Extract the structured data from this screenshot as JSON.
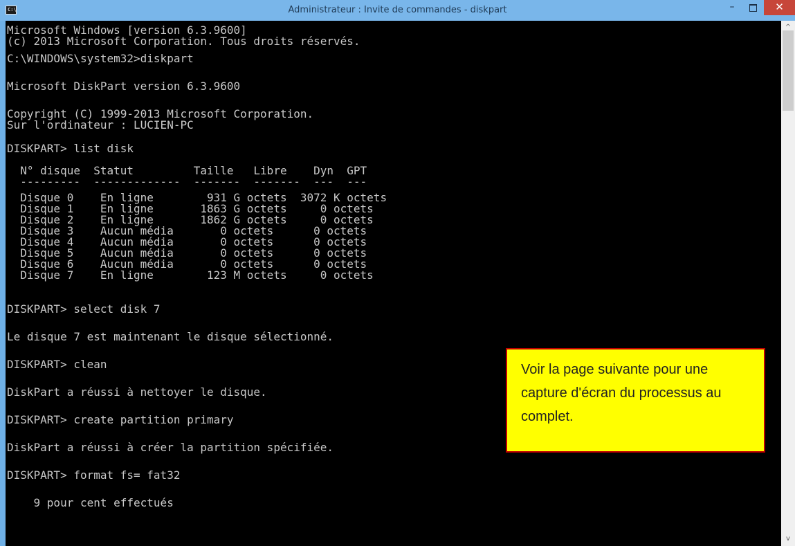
{
  "window": {
    "title": "Administrateur : Invite de commandes - diskpart",
    "icon_text": "C:\\",
    "min_glyph": "–",
    "close_glyph": "✕"
  },
  "scrollbar": {
    "up_glyph": "^",
    "down_glyph": "v"
  },
  "console": {
    "lines": [
      "Microsoft Windows [version 6.3.9600]",
      "(c) 2013 Microsoft Corporation. Tous droits réservés.",
      "C:\\WINDOWS\\system32>diskpart",
      "Microsoft DiskPart version 6.3.9600",
      "Copyright (C) 1999-2013 Microsoft Corporation.",
      "Sur l'ordinateur : LUCIEN-PC",
      "DISKPART> list disk",
      "  N° disque  Statut         Taille   Libre    Dyn  GPT",
      "  ---------  -------------  -------  -------  ---  ---",
      "  Disque 0    En ligne        931 G octets  3072 K octets",
      "  Disque 1    En ligne       1863 G octets     0 octets",
      "  Disque 2    En ligne       1862 G octets     0 octets",
      "  Disque 3    Aucun média       0 octets      0 octets",
      "  Disque 4    Aucun média       0 octets      0 octets",
      "  Disque 5    Aucun média       0 octets      0 octets",
      "  Disque 6    Aucun média       0 octets      0 octets",
      "  Disque 7    En ligne        123 M octets     0 octets",
      "DISKPART> select disk 7",
      "Le disque 7 est maintenant le disque sélectionné.",
      "DISKPART> clean",
      "DiskPart a réussi à nettoyer le disque.",
      "DISKPART> create partition primary",
      "DiskPart a réussi à créer la partition spécifiée.",
      "DISKPART> format fs= fat32",
      "    9 pour cent effectués"
    ]
  },
  "callout": {
    "text": "Voir la page suivante pour une capture d'écran du processus au complet."
  }
}
